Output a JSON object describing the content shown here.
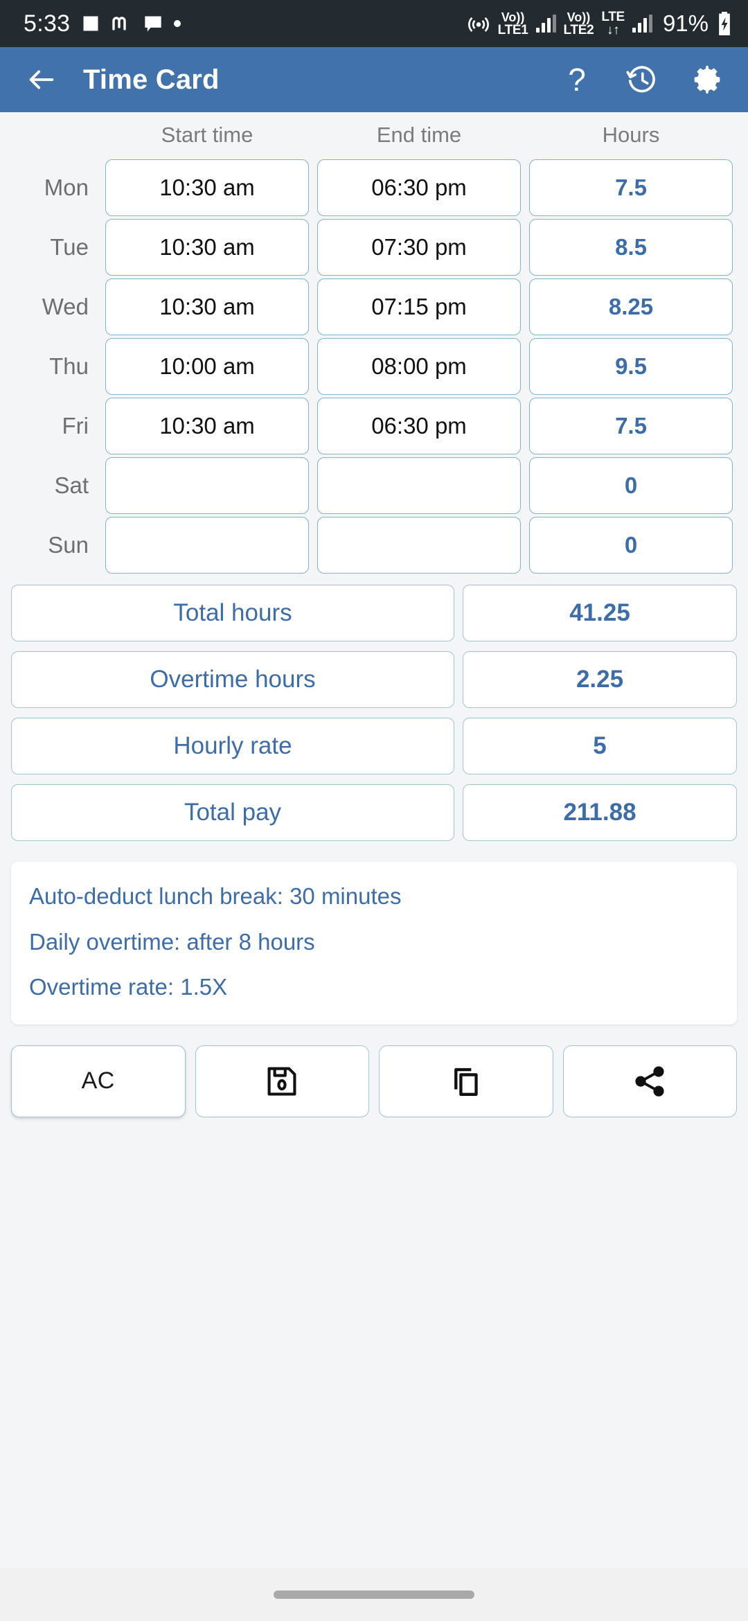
{
  "status_bar": {
    "time": "5:33",
    "notif_icons": [
      "image-icon",
      "m-app-icon",
      "chat-bubble-icon",
      "dot-icon"
    ],
    "hotspot_icon": "hotspot-icon",
    "sim1": {
      "volte_top": "Vo))",
      "volte_bottom": "LTE1"
    },
    "sim2": {
      "volte_top": "Vo))",
      "volte_bottom": "LTE2",
      "net_label": "LTE",
      "data_arrows": "↓↑"
    },
    "battery_percent": "91%",
    "battery_icon": "battery-charging-icon"
  },
  "app_bar": {
    "back_icon": "back-arrow-icon",
    "title": "Time Card",
    "help_label": "?",
    "help_icon": "help-icon",
    "history_icon": "history-clock-icon",
    "settings_icon": "settings-gear-icon",
    "background_color": "#4172ab"
  },
  "table": {
    "headers": [
      "",
      "Start time",
      "End time",
      "Hours"
    ],
    "rows": [
      {
        "day": "Mon",
        "start": "10:30 am",
        "end": "06:30 pm",
        "hours": "7.5"
      },
      {
        "day": "Tue",
        "start": "10:30 am",
        "end": "07:30 pm",
        "hours": "8.5"
      },
      {
        "day": "Wed",
        "start": "10:30 am",
        "end": "07:15 pm",
        "hours": "8.25"
      },
      {
        "day": "Thu",
        "start": "10:00 am",
        "end": "08:00 pm",
        "hours": "9.5"
      },
      {
        "day": "Fri",
        "start": "10:30 am",
        "end": "06:30 pm",
        "hours": "7.5"
      },
      {
        "day": "Sat",
        "start": "",
        "end": "",
        "hours": "0"
      },
      {
        "day": "Sun",
        "start": "",
        "end": "",
        "hours": "0"
      }
    ]
  },
  "summary": [
    {
      "label": "Total hours",
      "value": "41.25"
    },
    {
      "label": "Overtime hours",
      "value": "2.25"
    },
    {
      "label": "Hourly rate",
      "value": "5"
    },
    {
      "label": "Total pay",
      "value": "211.88"
    }
  ],
  "info": {
    "lines": [
      "Auto-deduct lunch break: 30 minutes",
      "Daily overtime: after 8 hours",
      "Overtime rate: 1.5X"
    ]
  },
  "actions": [
    {
      "label": "AC",
      "icon": ""
    },
    {
      "label": "",
      "icon": "save-floppy-icon"
    },
    {
      "label": "",
      "icon": "copy-icon"
    },
    {
      "label": "",
      "icon": "share-icon"
    }
  ],
  "colors": {
    "accent_blue": "#3d6da8",
    "app_bar_blue": "#4172ab",
    "cell_border": "#82b4cd",
    "page_background": "#f4f5f6",
    "status_bar": "#232b31"
  }
}
